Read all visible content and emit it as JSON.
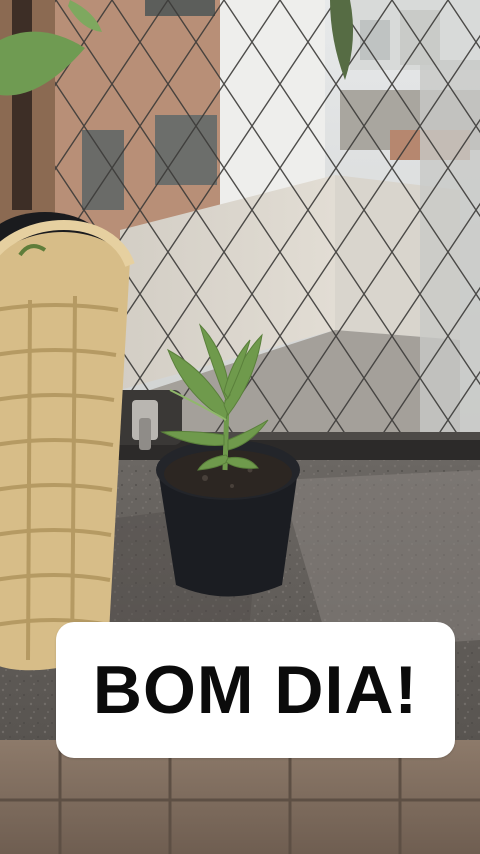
{
  "caption": {
    "text": "BOM DIA!",
    "background_color": "#ffffff",
    "text_color": "#0b0b0b"
  },
  "scene": {
    "icons": [
      "potted-plant-icon",
      "wicker-basket-icon",
      "wire-fence-icon",
      "window-latch-icon"
    ],
    "colors": {
      "granite_sill": "#5e5a57",
      "basket": "#d9bf8c",
      "pot": "#1b1d22",
      "leaf": "#6f9a4c",
      "building": "#b9917a"
    }
  }
}
